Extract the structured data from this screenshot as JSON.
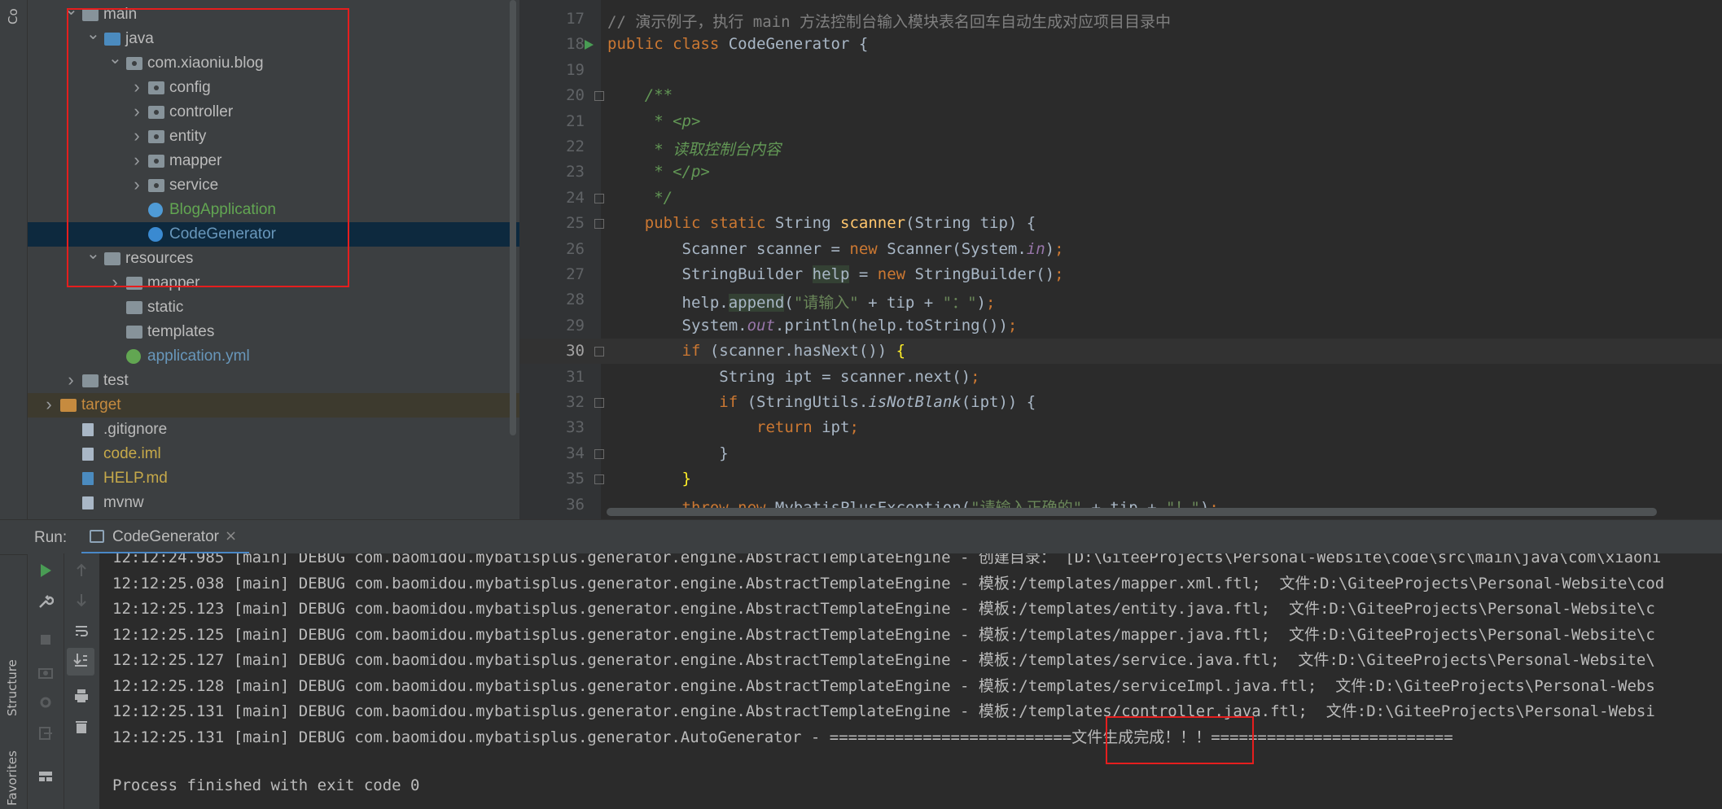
{
  "left_stripe": {
    "project_label": "Co",
    "structure_label": "Structure",
    "favorites_label": "Favorites"
  },
  "tree": [
    {
      "label": "main",
      "indent": 1,
      "arrow": "down",
      "icon": "folder",
      "color": "#bbbbbb"
    },
    {
      "label": "java",
      "indent": 2,
      "arrow": "down",
      "icon": "folder-blue",
      "color": "#bbbbbb"
    },
    {
      "label": "com.xiaoniu.blog",
      "indent": 3,
      "arrow": "down",
      "icon": "package",
      "color": "#bbbbbb"
    },
    {
      "label": "config",
      "indent": 4,
      "arrow": "right",
      "icon": "package",
      "color": "#bbbbbb"
    },
    {
      "label": "controller",
      "indent": 4,
      "arrow": "right",
      "icon": "package",
      "color": "#bbbbbb"
    },
    {
      "label": "entity",
      "indent": 4,
      "arrow": "right",
      "icon": "package",
      "color": "#bbbbbb"
    },
    {
      "label": "mapper",
      "indent": 4,
      "arrow": "right",
      "icon": "package",
      "color": "#bbbbbb"
    },
    {
      "label": "service",
      "indent": 4,
      "arrow": "right",
      "icon": "package",
      "color": "#bbbbbb"
    },
    {
      "label": "BlogApplication",
      "indent": 4,
      "arrow": "",
      "icon": "spring-class",
      "color": "#62a652"
    },
    {
      "label": "CodeGenerator",
      "indent": 4,
      "arrow": "",
      "icon": "class",
      "color": "#6897bb",
      "selected": true
    },
    {
      "label": "resources",
      "indent": 2,
      "arrow": "down",
      "icon": "folder-res",
      "color": "#bbbbbb"
    },
    {
      "label": "mapper",
      "indent": 3,
      "arrow": "right",
      "icon": "folder",
      "color": "#bbbbbb"
    },
    {
      "label": "static",
      "indent": 3,
      "arrow": "",
      "icon": "folder",
      "color": "#bbbbbb"
    },
    {
      "label": "templates",
      "indent": 3,
      "arrow": "",
      "icon": "folder",
      "color": "#bbbbbb"
    },
    {
      "label": "application.yml",
      "indent": 3,
      "arrow": "",
      "icon": "yml",
      "color": "#6897bb"
    },
    {
      "label": "test",
      "indent": 1,
      "arrow": "right",
      "icon": "folder",
      "color": "#bbbbbb"
    },
    {
      "label": "target",
      "indent": 0,
      "arrow": "right",
      "icon": "folder-orange",
      "color": "#c68b3f",
      "excluded": true
    },
    {
      "label": ".gitignore",
      "indent": 1,
      "arrow": "",
      "icon": "file",
      "color": "#bbbbbb"
    },
    {
      "label": "code.iml",
      "indent": 1,
      "arrow": "",
      "icon": "file",
      "color": "#c6a94a"
    },
    {
      "label": "HELP.md",
      "indent": 1,
      "arrow": "",
      "icon": "md",
      "color": "#c6a94a"
    },
    {
      "label": "mvnw",
      "indent": 1,
      "arrow": "",
      "icon": "file",
      "color": "#bbbbbb"
    }
  ],
  "editor": {
    "lines": [
      {
        "n": "17",
        "html": "<span class='cmt'>// 演示例子，执行 main 方法控制台输入模块表名回车自动生成对应项目目录中</span>"
      },
      {
        "n": "18",
        "html": "<span class='k'>public class </span>CodeGenerator {",
        "run": true
      },
      {
        "n": "19",
        "html": ""
      },
      {
        "n": "20",
        "html": "    <span class='doc'>/**</span>",
        "fold": true
      },
      {
        "n": "21",
        "html": "<span class='doc'>     * &lt;p&gt;</span>"
      },
      {
        "n": "22",
        "html": "<span class='doc'>     * 读取控制台内容</span>"
      },
      {
        "n": "23",
        "html": "<span class='doc'>     * &lt;/p&gt;</span>"
      },
      {
        "n": "24",
        "html": "<span class='doc'>     */</span>",
        "fold": true
      },
      {
        "n": "25",
        "html": "    <span class='k'>public static </span>String <span class='fn'>scanner</span>(String tip) {",
        "fold": true
      },
      {
        "n": "26",
        "html": "        Scanner scanner = <span class='k'>new </span>Scanner(System.<span class='st'>in</span>)<span class='k'>;</span>"
      },
      {
        "n": "27",
        "html": "        StringBuilder <span class='hl'>help</span> = <span class='k'>new </span>StringBuilder()<span class='k'>;</span>"
      },
      {
        "n": "28",
        "html": "        help.<span class='hl'>append</span>(<span class='str'>\"请输入\"</span> + tip + <span class='str'>\"：\"</span>)<span class='k'>;</span>"
      },
      {
        "n": "29",
        "html": "        System.<span class='st'>out</span>.println(help.toString())<span class='k'>;</span>"
      },
      {
        "n": "30",
        "html": "        <span class='k'>if </span>(scanner.hasNext()) <span style='color:#ffef28'>{</span>",
        "fold": true,
        "current": true
      },
      {
        "n": "31",
        "html": "            String ipt = scanner.next()<span class='k'>;</span>"
      },
      {
        "n": "32",
        "html": "            <span class='k'>if </span>(StringUtils.<span class='ital'>isNotBlank</span>(ipt)) {",
        "fold": true
      },
      {
        "n": "33",
        "html": "                <span class='k'>return </span>ipt<span class='k'>;</span>"
      },
      {
        "n": "34",
        "html": "            }",
        "fold": true
      },
      {
        "n": "35",
        "html": "        <span style='color:#ffef28'>}</span>",
        "fold": true
      },
      {
        "n": "36",
        "html": "        <span class='k'>throw new </span>MybatisPlusException(<span class='str'>\"请输入正确的\"</span> + tip + <span class='str'>\"！\"</span>)<span class='k'>;</span>"
      }
    ]
  },
  "run_bar": {
    "run_label": "Run:",
    "tab_label": "CodeGenerator",
    "close": "×"
  },
  "console_lines": [
    "12:12:24.985 [main] DEBUG com.baomidou.mybatisplus.generator.engine.AbstractTemplateEngine - 创建目录： [D:\\GiteeProjects\\Personal-Website\\code\\src\\main\\java\\com\\xiaoni",
    "12:12:25.038 [main] DEBUG com.baomidou.mybatisplus.generator.engine.AbstractTemplateEngine - 模板:/templates/mapper.xml.ftl;  文件:D:\\GiteeProjects\\Personal-Website\\cod",
    "12:12:25.123 [main] DEBUG com.baomidou.mybatisplus.generator.engine.AbstractTemplateEngine - 模板:/templates/entity.java.ftl;  文件:D:\\GiteeProjects\\Personal-Website\\c",
    "12:12:25.125 [main] DEBUG com.baomidou.mybatisplus.generator.engine.AbstractTemplateEngine - 模板:/templates/mapper.java.ftl;  文件:D:\\GiteeProjects\\Personal-Website\\c",
    "12:12:25.127 [main] DEBUG com.baomidou.mybatisplus.generator.engine.AbstractTemplateEngine - 模板:/templates/service.java.ftl;  文件:D:\\GiteeProjects\\Personal-Website\\",
    "12:12:25.128 [main] DEBUG com.baomidou.mybatisplus.generator.engine.AbstractTemplateEngine - 模板:/templates/serviceImpl.java.ftl;  文件:D:\\GiteeProjects\\Personal-Webs",
    "12:12:25.131 [main] DEBUG com.baomidou.mybatisplus.generator.engine.AbstractTemplateEngine - 模板:/templates/controller.java.ftl;  文件:D:\\GiteeProjects\\Personal-Websi",
    "12:12:25.131 [main] DEBUG com.baomidou.mybatisplus.generator.AutoGenerator - ==========================文件生成完成！！！==========================",
    "",
    "Process finished with exit code 0"
  ],
  "colors": {
    "accent_red": "#e51e1e",
    "run_green": "#499c54"
  }
}
